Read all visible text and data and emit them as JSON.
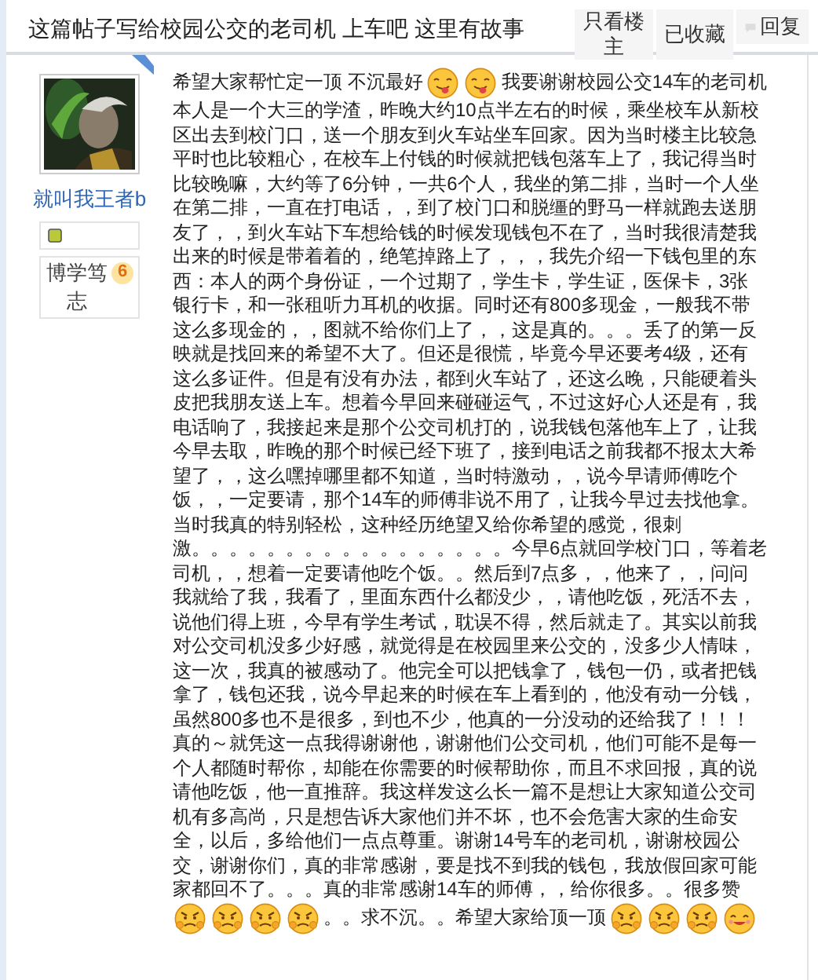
{
  "header": {
    "title": "这篇帖子写给校园公交的老司机 上车吧 这里有故事",
    "buttons": [
      {
        "label": "只看楼主",
        "kind": "plain"
      },
      {
        "label": "已收藏",
        "kind": "plain"
      },
      {
        "label": "回复",
        "kind": "reply"
      }
    ]
  },
  "author": {
    "name": "就叫我王者b",
    "title": "博学笃志",
    "level": "6"
  },
  "post": {
    "lines": [
      [
        {
          "kind": "text",
          "text": "希望大家帮忙定一顶 不沉最好"
        },
        {
          "kind": "tongue"
        },
        {
          "kind": "tongue"
        },
        {
          "kind": "text",
          "text": "我要谢谢校园公交14车的老司机"
        }
      ],
      [
        {
          "kind": "text",
          "text": "本人是一个大三的学渣，昨晚大约10点半左右的时候，乘坐校车从新校"
        }
      ],
      [
        {
          "kind": "text",
          "text": "区出去到校门口，送一个朋友到火车站坐车回家。因为当时楼主比较急"
        }
      ],
      [
        {
          "kind": "text",
          "text": "平时也比较粗心，在校车上付钱的时候就把钱包落车上了，我记得当时"
        }
      ],
      [
        {
          "kind": "text",
          "text": "比较晚嘛，大约等了6分钟，一共6个人，我坐的第二排，当时一个人坐"
        }
      ],
      [
        {
          "kind": "text",
          "text": "在第二排，一直在打电话，，到了校门口和脱缰的野马一样就跑去送朋"
        }
      ],
      [
        {
          "kind": "text",
          "text": "友了，，到火车站下车想给钱的时候发现钱包不在了，当时我很清楚我"
        }
      ],
      [
        {
          "kind": "text",
          "text": "出来的时候是带着着的，绝笔掉路上了，，，我先介绍一下钱包里的东"
        }
      ],
      [
        {
          "kind": "text",
          "text": "西：本人的两个身份证，一个过期了，学生卡，学生证，医保卡，3张"
        }
      ],
      [
        {
          "kind": "text",
          "text": "银行卡，和一张租听力耳机的收据。同时还有800多现金，一般我不带"
        }
      ],
      [
        {
          "kind": "text",
          "text": "这么多现金的，，图就不给你们上了，，这是真的。。。丢了的第一反"
        }
      ],
      [
        {
          "kind": "text",
          "text": "映就是找回来的希望不大了。但还是很慌，毕竟今早还要考4级，还有"
        }
      ],
      [
        {
          "kind": "text",
          "text": "这么多证件。但是有没有办法，都到火车站了，还这么晚，只能硬着头"
        }
      ],
      [
        {
          "kind": "text",
          "text": "皮把我朋友送上车。想着今早回来碰碰运气，不过这好心人还是有，我"
        }
      ],
      [
        {
          "kind": "text",
          "text": "电话响了，我接起来是那个公交司机打的，说我钱包落他车上了，让我"
        }
      ],
      [
        {
          "kind": "text",
          "text": "今早去取，昨晚的那个时候已经下班了，接到电话之前我都不报太大希"
        }
      ],
      [
        {
          "kind": "text",
          "text": "望了，，这么嘿掉哪里都不知道，当时特激动，，说今早请师傅吃个"
        }
      ],
      [
        {
          "kind": "text",
          "text": "饭，，一定要请，那个14车的师傅非说不用了，让我今早过去找他拿。"
        }
      ],
      [
        {
          "kind": "text",
          "text": "当时我真的特别轻松，这种经历绝望又给你希望的感觉，很刺"
        }
      ],
      [
        {
          "kind": "text",
          "text": "激。。。。。。。。。。。。。。。。。今早6点就回学校门口，等着老"
        }
      ],
      [
        {
          "kind": "text",
          "text": "司机，，想着一定要请他吃个饭。。然后到7点多，，他来了，，问问"
        }
      ],
      [
        {
          "kind": "text",
          "text": "我就给了我，我看了，里面东西什么都没少，，请他吃饭，死活不去，"
        }
      ],
      [
        {
          "kind": "text",
          "text": "说他们得上班，今早有学生考试，耽误不得，然后就走了。其实以前我"
        }
      ],
      [
        {
          "kind": "text",
          "text": "对公交司机没多少好感，就觉得是在校园里来公交的，没多少人情味，"
        }
      ],
      [
        {
          "kind": "text",
          "text": "这一次，我真的被感动了。他完全可以把钱拿了，钱包一仍，或者把钱"
        }
      ],
      [
        {
          "kind": "text",
          "text": "拿了，钱包还我，说今早起来的时候在车上看到的，他没有动一分钱，"
        }
      ],
      [
        {
          "kind": "text",
          "text": "虽然800多也不是很多，到也不少，他真的一分没动的还给我了！！！"
        }
      ],
      [
        {
          "kind": "text",
          "text": "真的～就凭这一点我得谢谢他，谢谢他们公交司机，他们可能不是每一"
        }
      ],
      [
        {
          "kind": "text",
          "text": "个人都随时帮你，却能在你需要的时候帮助你，而且不求回报，真的说"
        }
      ],
      [
        {
          "kind": "text",
          "text": "请他吃饭，他一直推辞。我这样发这么长一篇不是想让大家知道公交司"
        }
      ],
      [
        {
          "kind": "text",
          "text": "机有多高尚，只是想告诉大家他们并不坏，也不会危害大家的生命安"
        }
      ],
      [
        {
          "kind": "text",
          "text": "全，以后，多给他们一点点尊重。谢谢14号车的老司机，谢谢校园公"
        }
      ],
      [
        {
          "kind": "text",
          "text": "交，谢谢你们，真的非常感谢，要是找不到我的钱包，我放假回家可能"
        }
      ],
      [
        {
          "kind": "text",
          "text": "家都回不了。。。真的非常感谢14车的师傅，，给你很多。。很多赞"
        }
      ],
      [
        {
          "kind": "angry"
        },
        {
          "kind": "angry"
        },
        {
          "kind": "angry"
        },
        {
          "kind": "angry"
        },
        {
          "kind": "text",
          "text": "。。求不沉。。希望大家给顶一顶"
        },
        {
          "kind": "angry"
        },
        {
          "kind": "angry"
        },
        {
          "kind": "angry"
        },
        {
          "kind": "smile"
        }
      ]
    ]
  }
}
